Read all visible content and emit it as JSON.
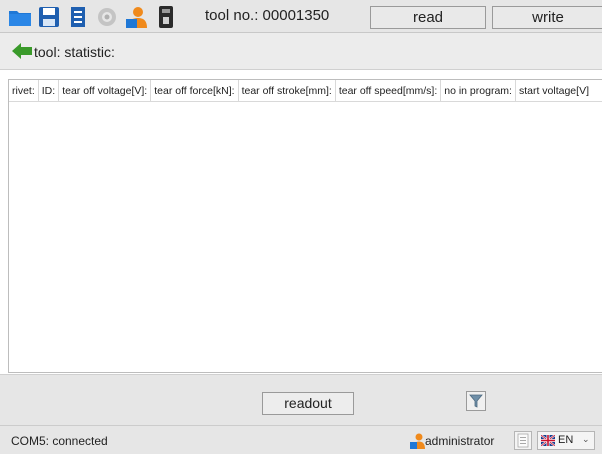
{
  "toolbar": {
    "icons": [
      "folder-icon",
      "save-icon",
      "list-icon",
      "settings-gear-icon",
      "user-icon",
      "device-icon"
    ],
    "tool_no_label": "tool no.: 00001350",
    "read_label": "read",
    "write_label": "write"
  },
  "titlebar": {
    "title": "tool: statistic:"
  },
  "table": {
    "columns": [
      "rivet:",
      "ID:",
      "tear off voltage[V]:",
      "tear off force[kN]:",
      "tear off stroke[mm]:",
      "tear off speed[mm/s]:",
      "no in program:",
      "start voltage[V]"
    ],
    "rows": []
  },
  "bottombar": {
    "readout_label": "readout",
    "filter_icon": "filter-icon"
  },
  "statusbar": {
    "connection": "COM5: connected",
    "user": "administrator",
    "language": "EN"
  },
  "colors": {
    "chrome": "#e6e6e6",
    "border": "#9a9a9a",
    "accent_blue": "#1f6fd1",
    "accent_orange": "#f08a1c",
    "arrow_green": "#3a9a2a"
  }
}
